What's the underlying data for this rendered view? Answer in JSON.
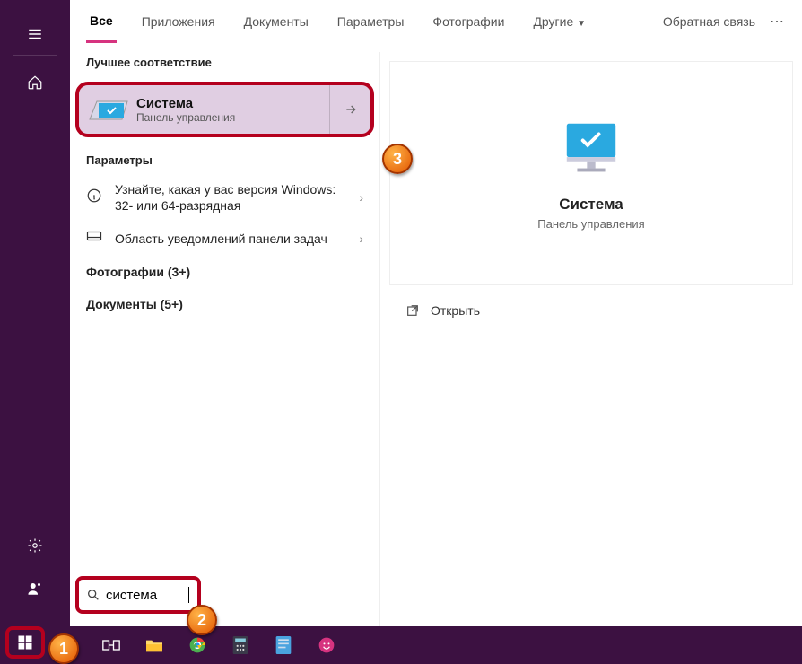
{
  "tabs": {
    "all": "Все",
    "apps": "Приложения",
    "docs": "Документы",
    "settings": "Параметры",
    "photos": "Фотографии",
    "other": "Другие",
    "feedback": "Обратная связь"
  },
  "sections": {
    "best_match": "Лучшее соответствие",
    "params": "Параметры"
  },
  "result": {
    "title": "Система",
    "subtitle": "Панель управления"
  },
  "list": {
    "item1": "Узнайте, какая у вас версия Windows: 32- или 64-разрядная",
    "item2": "Область уведомлений панели задач"
  },
  "summaries": {
    "photos": "Фотографии (3+)",
    "docs": "Документы (5+)"
  },
  "preview": {
    "title": "Система",
    "subtitle": "Панель управления",
    "open": "Открыть"
  },
  "search": {
    "query": "система"
  },
  "callouts": {
    "c1": "1",
    "c2": "2",
    "c3": "3"
  }
}
